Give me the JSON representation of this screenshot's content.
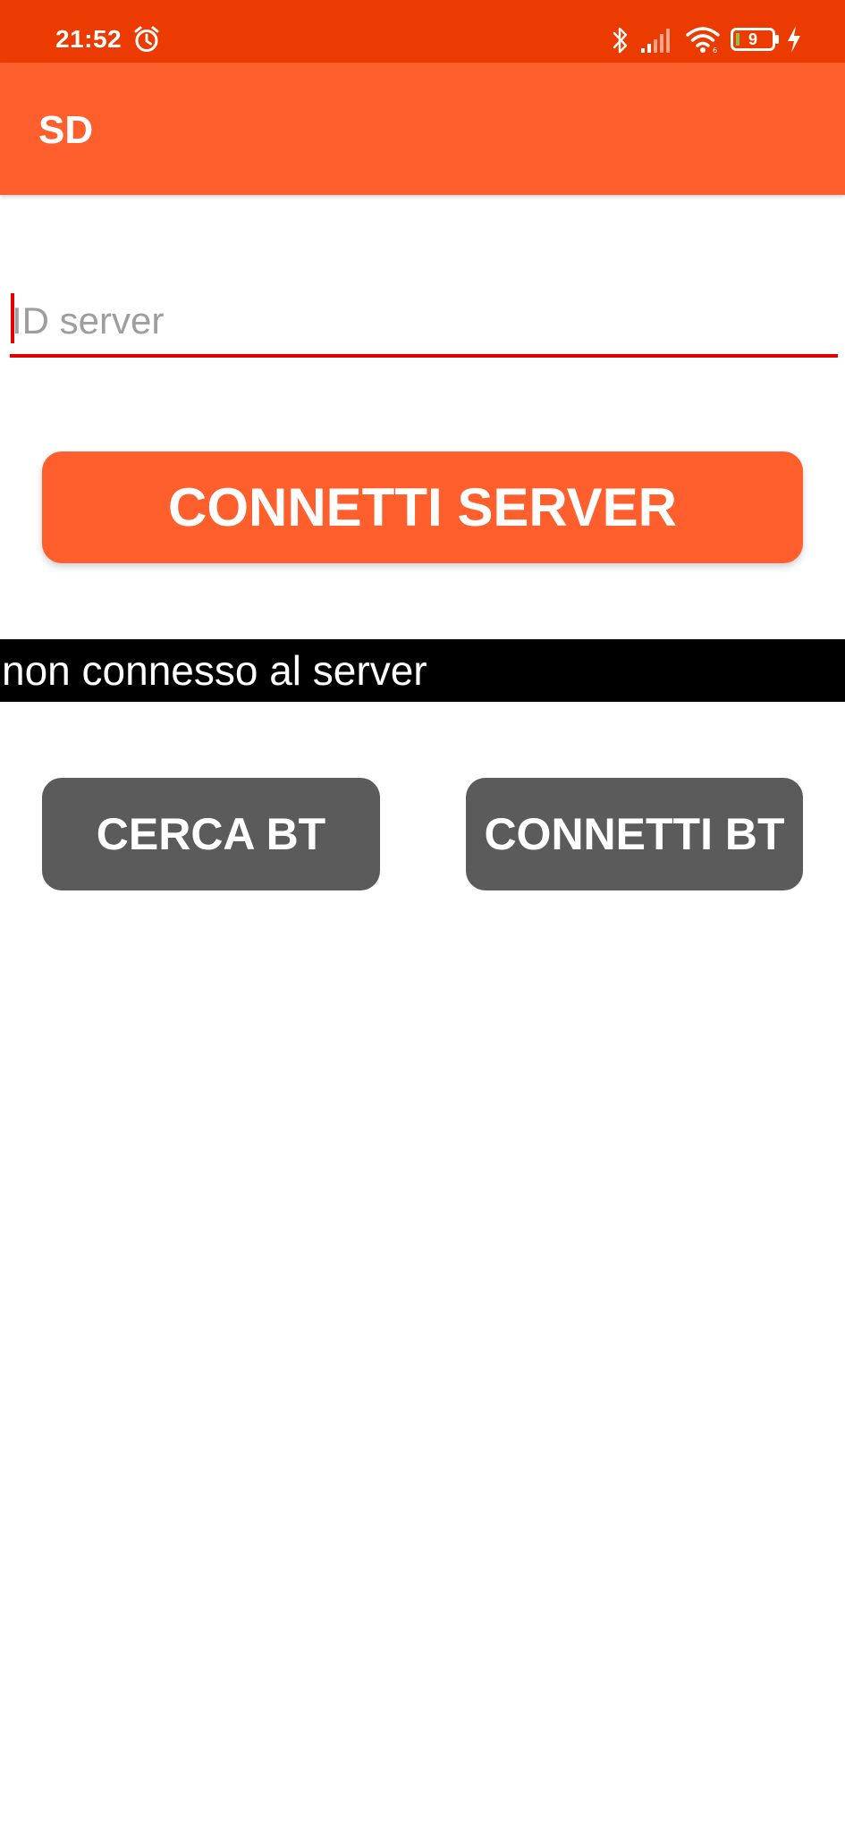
{
  "status_bar": {
    "time": "21:52",
    "battery_level": "9",
    "icons": [
      "alarm-icon",
      "bluetooth-icon",
      "signal-icon",
      "wifi-icon",
      "battery-icon",
      "charging-icon"
    ],
    "background_color": "#ec3b00"
  },
  "app_bar": {
    "title": "SD",
    "background_color": "#ff5e2d"
  },
  "server_input": {
    "value": "",
    "placeholder": "ID server",
    "underline_color": "#e50000"
  },
  "connect_server_button": {
    "label": "CONNETTI SERVER",
    "color": "#ff5e2d"
  },
  "server_status": {
    "text": "non connesso al server"
  },
  "bt_buttons": {
    "search_label": "CERCA BT",
    "connect_label": "CONNETTI BT",
    "color": "#5b5b5b"
  }
}
